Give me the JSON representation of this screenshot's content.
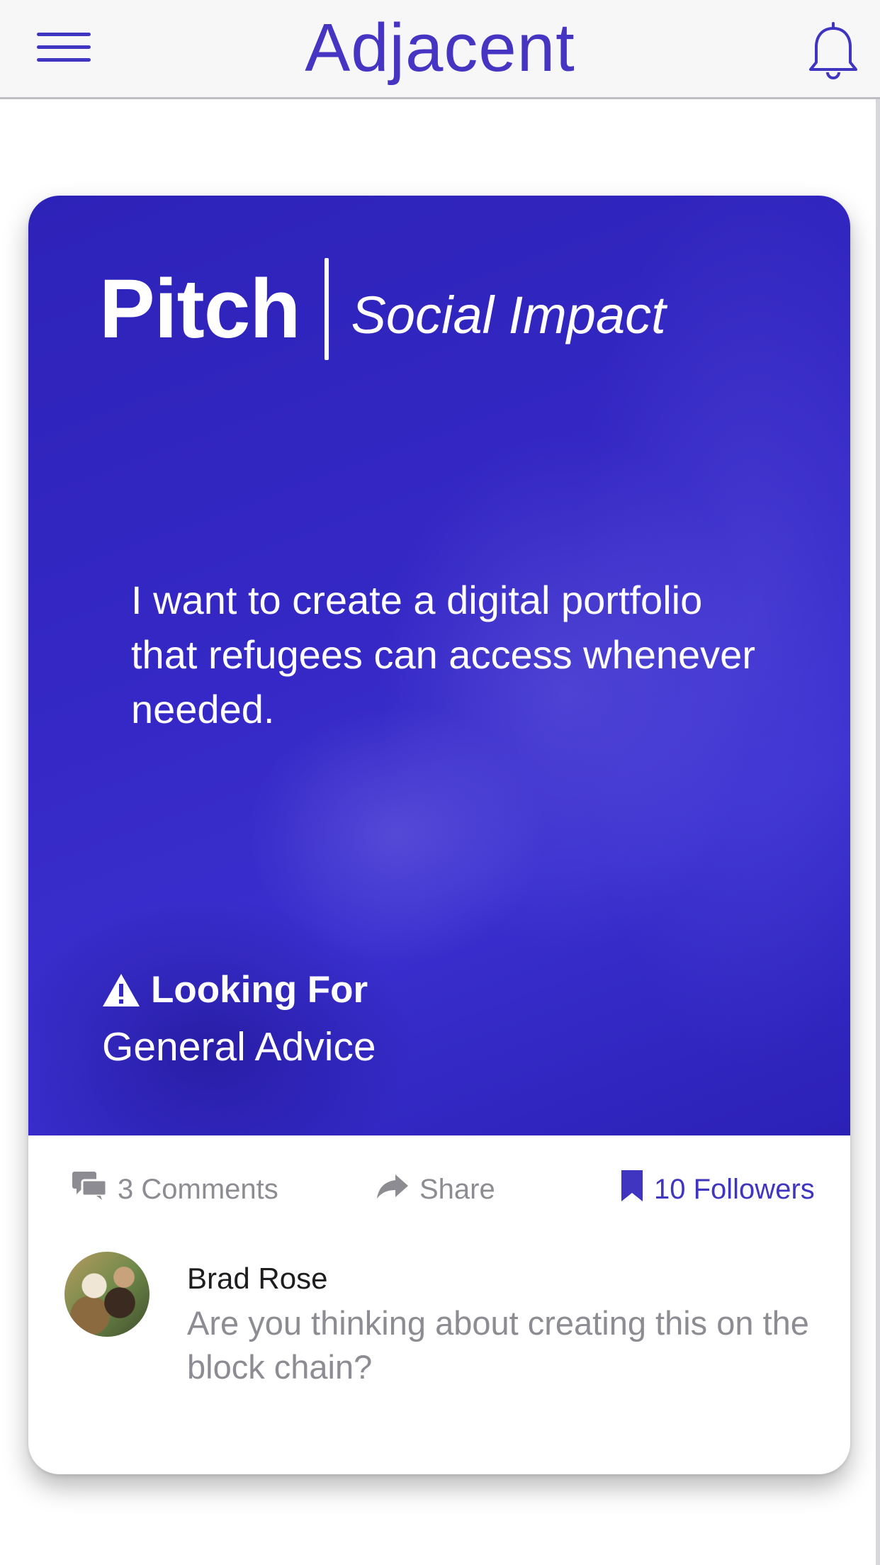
{
  "app": {
    "brand": "Adjacent"
  },
  "header": {
    "menu_icon": "hamburger-menu-icon",
    "notification_icon": "bell-icon"
  },
  "card": {
    "type_label": "Pitch",
    "category": "Social Impact",
    "pitch_text": "I want to create a digital portfolio that refugees can access whenever needed.",
    "looking_for_label": "Looking For",
    "looking_for_icon": "warning-icon",
    "looking_for_value": "General Advice",
    "hero_color": "#3328c4",
    "actions": {
      "comments": {
        "label": "3 Comments",
        "icon": "comments-icon"
      },
      "share": {
        "label": "Share",
        "icon": "share-arrow-icon"
      },
      "followers": {
        "label": "10 Followers",
        "icon": "bookmark-icon"
      }
    },
    "comment": {
      "author": "Brad Rose",
      "text": "Are you thinking about creating this on the block chain?"
    }
  },
  "colors": {
    "accent": "#3f35c0",
    "muted": "#8c8c92",
    "text": "#1d1d1f"
  }
}
